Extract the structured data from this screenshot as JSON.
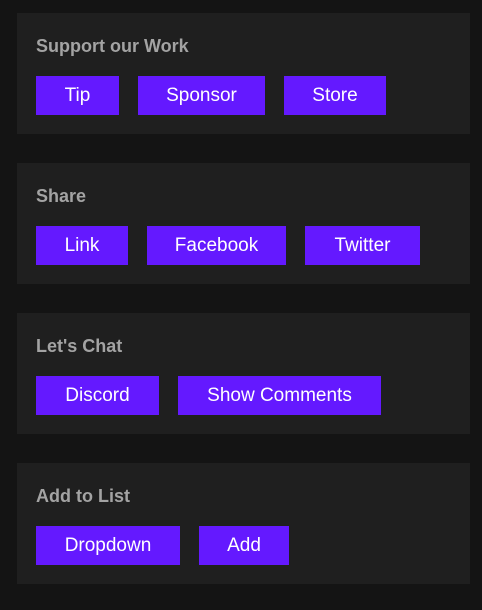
{
  "sections": [
    {
      "title": "Support our Work",
      "buttons": [
        "Tip",
        "Sponsor",
        "Store"
      ]
    },
    {
      "title": "Share",
      "buttons": [
        "Link",
        "Facebook",
        "Twitter"
      ]
    },
    {
      "title": "Let's Chat",
      "buttons": [
        "Discord",
        "Show Comments"
      ]
    },
    {
      "title": "Add to List",
      "buttons": [
        "Dropdown",
        "Add"
      ]
    }
  ],
  "colors": {
    "background": "#141414",
    "card": "#1f1f1f",
    "title_text": "#a3a3a3",
    "button": "#6419ff",
    "button_text": "#ffffff"
  }
}
